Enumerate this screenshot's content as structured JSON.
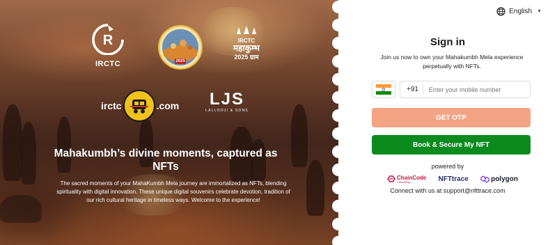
{
  "hero": {
    "logos": {
      "irctc": "IRCTC",
      "mela_year": "2025",
      "kumbh_small": "IRCTC",
      "kumbh_big": "महाकुम्भ",
      "kumbh_year": "2025 ग्राम",
      "irctc_com_left": "irctc",
      "irctc_com_right": ".com",
      "ljs": "LJS",
      "ljs_sub": "LALLOOJI & SONS"
    },
    "title": "Mahakumbh’s divine moments, captured as NFTs",
    "description": "The sacred moments of your MahaKumbh Mela journey are immortalized as NFTs, blending spirituality with digital innovation. These unique digital souvenirs celebrate devotion, tradition of our rich cultural heritage in timeless ways. Welcome to the experience!"
  },
  "signin": {
    "language": "English",
    "language_icon": "globe-icon",
    "title": "Sign in",
    "subtitle": "Join us now to own your Mahakumbh Mela experience perpetually with NFTs.",
    "country_code": "+91",
    "country_flag": "india-flag-icon",
    "phone_placeholder": "Enter your mobile number",
    "phone_value": "",
    "otp_button": "GET OTP",
    "secure_button": "Book & Secure My NFT",
    "powered_by": "powered by",
    "partners": {
      "chaincode": "ChainCode",
      "chaincode_sub": "Consulting",
      "nfttrace": "NFTtrace",
      "polygon": "polygon"
    },
    "connect": "Connect with us at support@nfttrace.com"
  },
  "colors": {
    "otp_button": "#f4a384",
    "secure_button": "#0b8a1e",
    "flag_saffron": "#ff9933",
    "flag_white": "#ffffff",
    "flag_green": "#138808"
  }
}
